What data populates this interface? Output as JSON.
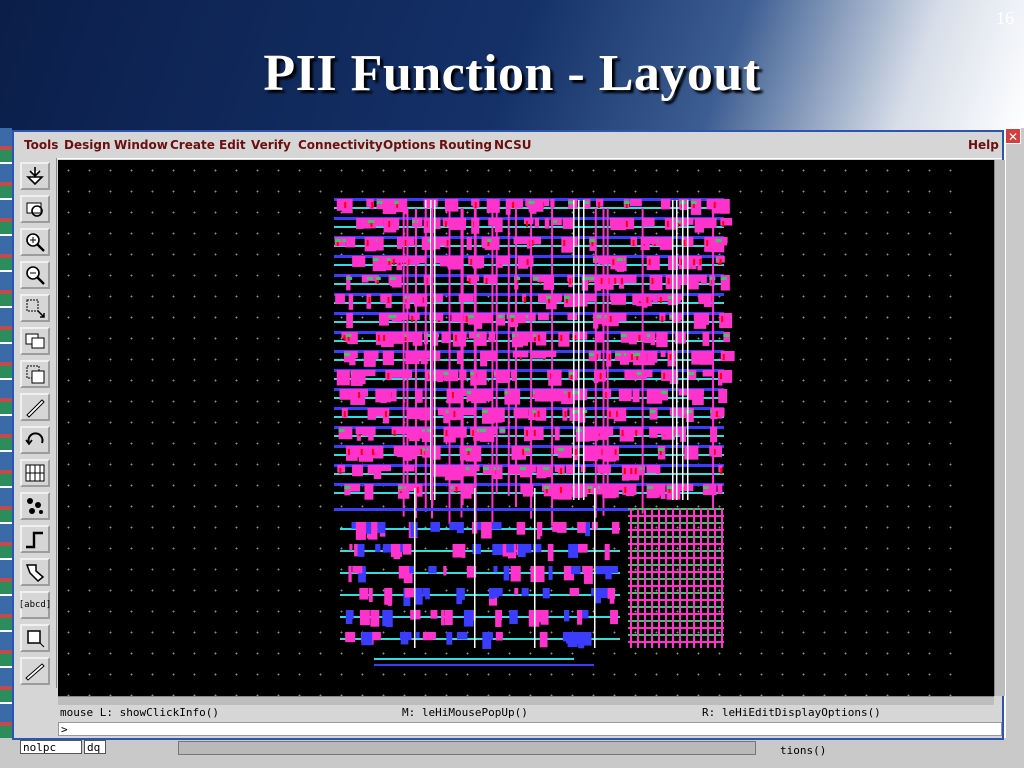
{
  "slide": {
    "number": "16",
    "title": "PII Function - Layout"
  },
  "window": {
    "menu": [
      "Tools",
      "Design",
      "Window",
      "Create",
      "Edit",
      "Verify",
      "Connectivity",
      "Options",
      "Routing",
      "NCSU"
    ],
    "help_label": "Help",
    "tools": [
      "fit-view-icon",
      "redraw-icon",
      "zoom-in-icon",
      "zoom-out-icon",
      "stretch-icon",
      "copy-icon",
      "move-icon",
      "delete-icon",
      "undo-icon",
      "property-icon",
      "instance-icon",
      "path-icon",
      "polygon-icon",
      "label-icon",
      "rectangle-icon",
      "ruler-icon"
    ],
    "label_tool_text": "[abcd]",
    "status": {
      "left": "mouse L: showClickInfo()",
      "middle": "M: leHiMousePopUp()",
      "right": "R: leHiEditDisplayOptions()"
    },
    "prompt": ">"
  },
  "background_windows": {
    "field1": "nolpc",
    "field2": "dq",
    "partial_text": "tions()"
  },
  "colors": {
    "metal1": "#3c3cff",
    "metal2": "#ff33cc",
    "poly": "#ff0000",
    "active": "#33cc66",
    "metal3": "#33dddd",
    "vias": "#ffffff",
    "menu_text": "#6b0f0f"
  }
}
